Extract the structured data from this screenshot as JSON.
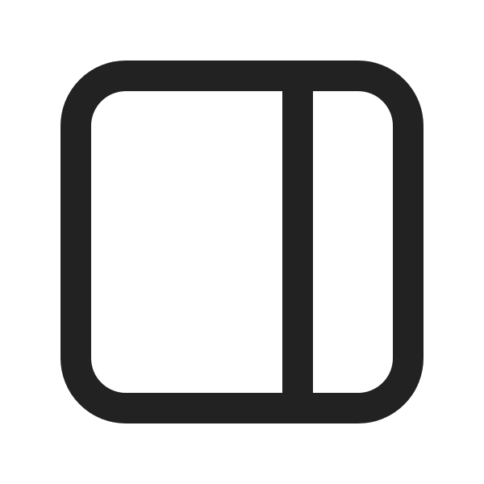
{
  "icon": {
    "name": "sidebar-right-panel-icon",
    "color": "#222222",
    "background": "#ffffff"
  }
}
